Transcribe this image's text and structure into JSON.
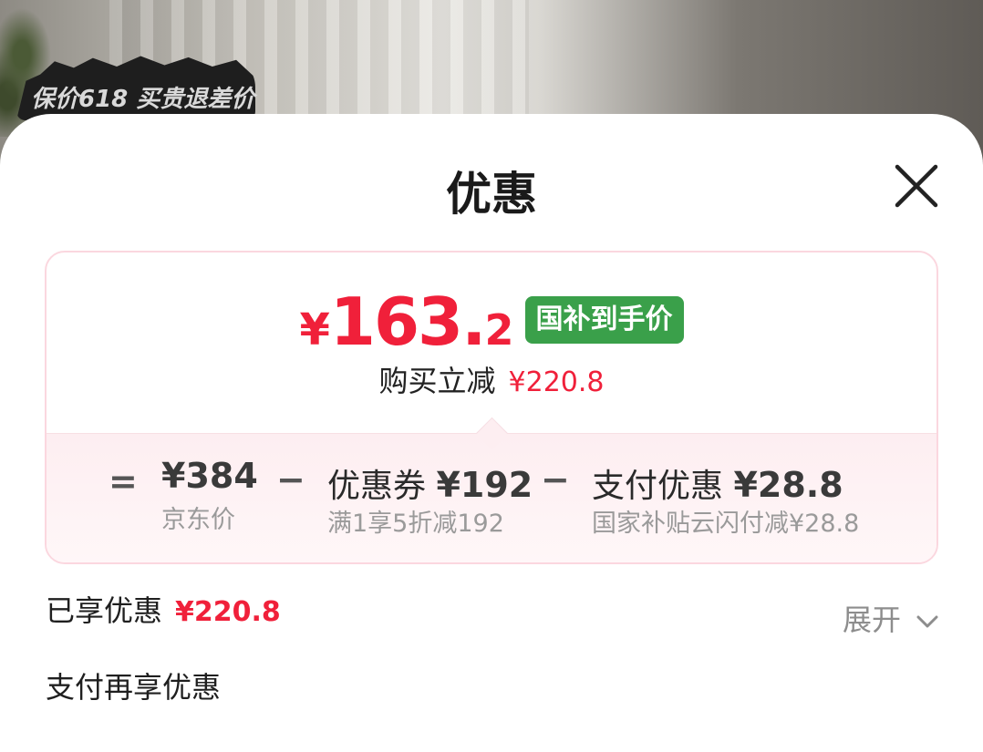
{
  "background": {
    "promo_badge_text": "保价618 买贵退差价"
  },
  "sheet": {
    "title": "优惠",
    "close_icon": "close-icon"
  },
  "price_card": {
    "currency": "¥",
    "final_price_int": "163.",
    "final_price_dec": "2",
    "subsidy_tag": "国补到手价",
    "instant_reduce_label": "购买立减",
    "instant_reduce_amount": "¥220.8",
    "breakdown": {
      "equals_sign": "=",
      "minus_sign": "−",
      "jd_price_amount": "¥384",
      "jd_price_label": "京东价",
      "coupon_label": "优惠券",
      "coupon_amount": "¥192",
      "coupon_desc": "满1享5折减192",
      "pay_discount_label": "支付优惠",
      "pay_discount_amount": "¥28.8",
      "pay_discount_desc": "国家补贴云闪付减¥28.8"
    }
  },
  "summary": {
    "enjoyed_label": "已享优惠",
    "enjoyed_amount": "¥220.8",
    "expand_label": "展开",
    "pay_more_label": "支付再享优惠"
  },
  "colors": {
    "accent_red": "#f0203a",
    "subsidy_green": "#3aa04a",
    "card_border": "#fbd7df"
  }
}
